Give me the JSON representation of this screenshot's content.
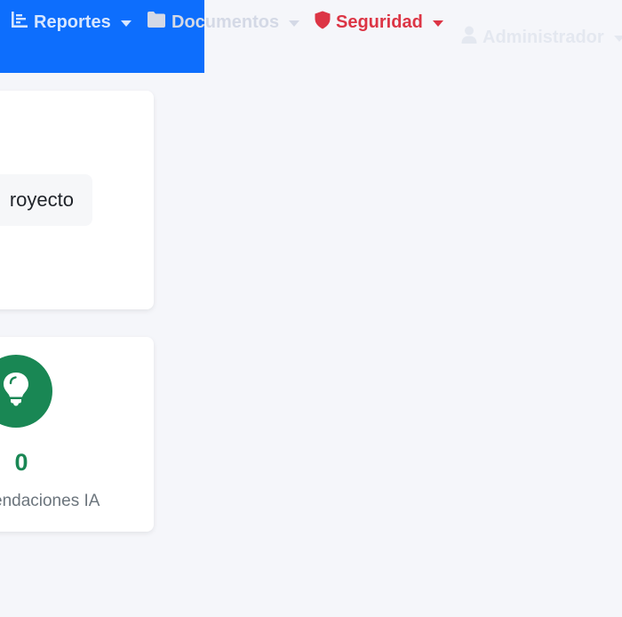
{
  "nav": {
    "reportes_label": "Reportes",
    "documentos_label": "Documentos",
    "seguridad_label": "Seguridad",
    "admin_label": "Administrador"
  },
  "card_top": {
    "project_label": "royecto"
  },
  "card_bottom": {
    "count": "0",
    "caption": "endaciones IA"
  },
  "colors": {
    "primary": "#0d6efd",
    "danger": "#dc3545",
    "success": "#198754"
  },
  "icons": [
    "chart-line-icon",
    "folder-icon",
    "shield-icon",
    "user-icon",
    "lightbulb-icon"
  ]
}
